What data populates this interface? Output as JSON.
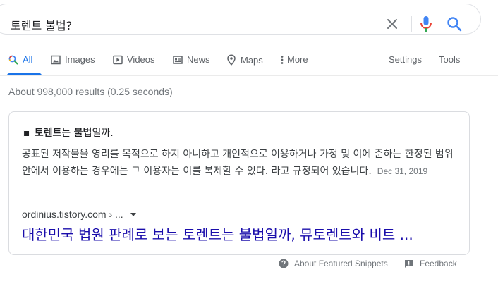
{
  "search": {
    "query": "토렌트 불법?"
  },
  "tabs": [
    {
      "label": "All",
      "icon": "search-icon",
      "active": true
    },
    {
      "label": "Images",
      "icon": "image-icon"
    },
    {
      "label": "Videos",
      "icon": "play-icon"
    },
    {
      "label": "News",
      "icon": "newspaper-icon"
    },
    {
      "label": "Maps",
      "icon": "map-pin-icon"
    },
    {
      "label": "More",
      "icon": "more-vertical-icon"
    }
  ],
  "tools": {
    "settings_label": "Settings",
    "tools_label": "Tools"
  },
  "result_stats": "About 998,000 results (0.25 seconds)",
  "snippet": {
    "title_prefix": "▣ ",
    "title_bold_1": "토렌트",
    "title_mid": "는 ",
    "title_bold_2": "불법",
    "title_suffix": "일까.",
    "body": "공표된 저작물을 영리를 목적으로 하지 아니하고 개인적으로 이용하거나 가정 및 이에 준하는 한정된 범위 안에서 이용하는 경우에는 그 이용자는 이를 복제할 수 있다. 라고 규정되어 있습니다.",
    "date": "Dec 31, 2019",
    "source": "ordinius.tistory.com › ...",
    "link_title": "대한민국 법원 판례로 보는 토렌트는 불법일까, 뮤토렌트와 비트 ..."
  },
  "footer": {
    "about_label": "About Featured Snippets",
    "feedback_label": "Feedback"
  },
  "colors": {
    "accent": "#1a73e8",
    "link": "#1a0dab",
    "muted": "#70757a",
    "mic_blue": "#4285f4",
    "mic_red": "#ea4335"
  }
}
